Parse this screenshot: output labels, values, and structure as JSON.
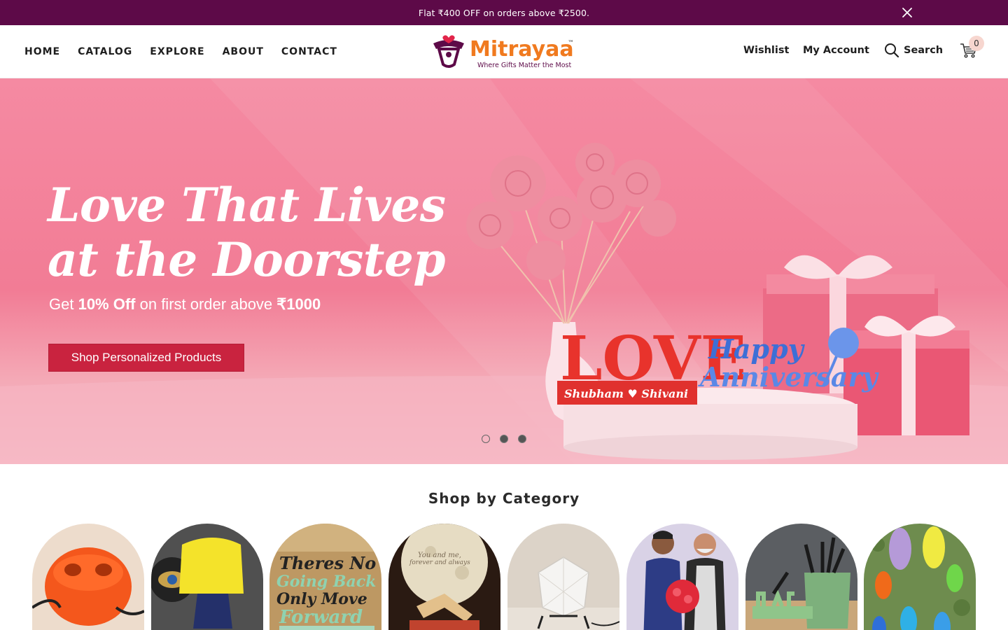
{
  "announcement": {
    "text": "Flat ₹400 OFF on orders above ₹2500.",
    "close_icon": "close-icon",
    "background": "#5d0a48"
  },
  "header": {
    "nav": [
      "HOME",
      "CATALOG",
      "EXPLORE",
      "ABOUT",
      "CONTACT"
    ],
    "logo": {
      "name": "Mitrayaa",
      "tm": "™",
      "tagline": "Where Gifts Matter the Most"
    },
    "wishlist": "Wishlist",
    "account": "My Account",
    "search": "Search",
    "cart_count": "0",
    "icons": [
      "search-icon",
      "cart-icon"
    ]
  },
  "hero": {
    "title_line1": "Love That Lives",
    "title_line2": "at the Doorstep",
    "offer_prefix": "Get ",
    "offer_bold": "10% Off",
    "offer_middle": " on first order above ",
    "offer_amount": "₹1000",
    "button": "Shop Personalized Products",
    "sign_love": "LOVE",
    "sign_names": "Shubham ♥ Shivani",
    "sign_happy": "Happy",
    "sign_anniv": "Anniversary",
    "slides_total": 3,
    "active_slide": 1
  },
  "categories": {
    "title": "Shop by Category",
    "items": [
      {
        "id": "cable-organizer",
        "bg": "#e9d7c7"
      },
      {
        "id": "lamp",
        "bg": "#4a4a4a"
      },
      {
        "id": "quote-sign",
        "bg": "#b9935f",
        "text_l1": "Theres No",
        "text_l2": "Going Back",
        "text_l3": "Only Move",
        "text_l4": "Forward"
      },
      {
        "id": "moon-lamp",
        "bg": "#2a1a12",
        "text_l1": "You and me,",
        "text_l2": "forever and always"
      },
      {
        "id": "geometric-lamp",
        "bg": "#e8e2da"
      },
      {
        "id": "figurines",
        "bg": "#ddd6e6"
      },
      {
        "id": "pen-stand",
        "bg": "#5a5d60"
      },
      {
        "id": "crayon-holders",
        "bg": "#7c9a5a"
      }
    ]
  }
}
